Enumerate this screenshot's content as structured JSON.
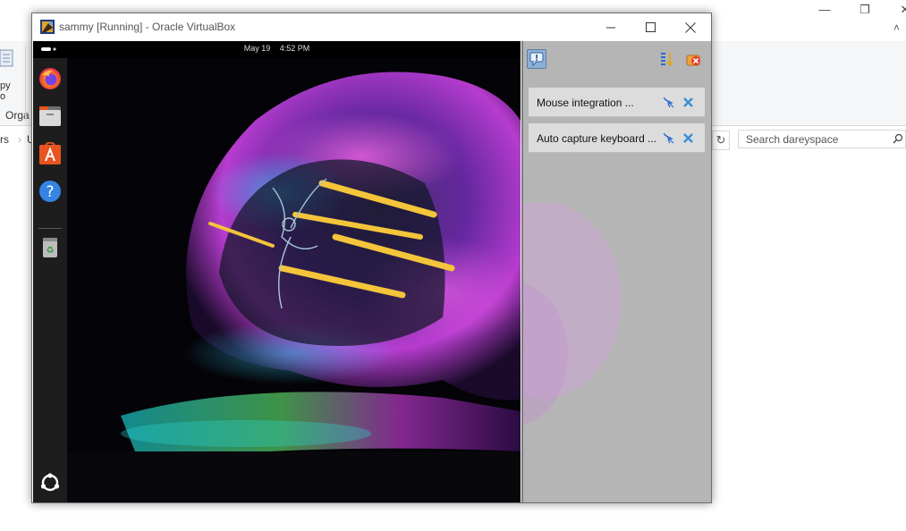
{
  "explorer": {
    "ribbon_copy": "py",
    "ribbon_copy2": "o",
    "ribbon_group": "Orga",
    "addr_left": "rs",
    "addr_seg": "U",
    "search_placeholder": "Search dareyspace"
  },
  "vbox": {
    "title": "sammy [Running] - Oracle VirtualBox"
  },
  "guest": {
    "date": "May 19",
    "time": "4:52 PM",
    "dock": [
      "firefox",
      "files",
      "software",
      "help",
      "trash",
      "show-apps"
    ]
  },
  "notifications": {
    "items": [
      {
        "label": "Mouse integration ..."
      },
      {
        "label": "Auto capture keyboard ..."
      }
    ]
  },
  "colors": {
    "accent": "#8fb0d6",
    "panel": "#afafaf",
    "dock": "#1d1d1d"
  }
}
